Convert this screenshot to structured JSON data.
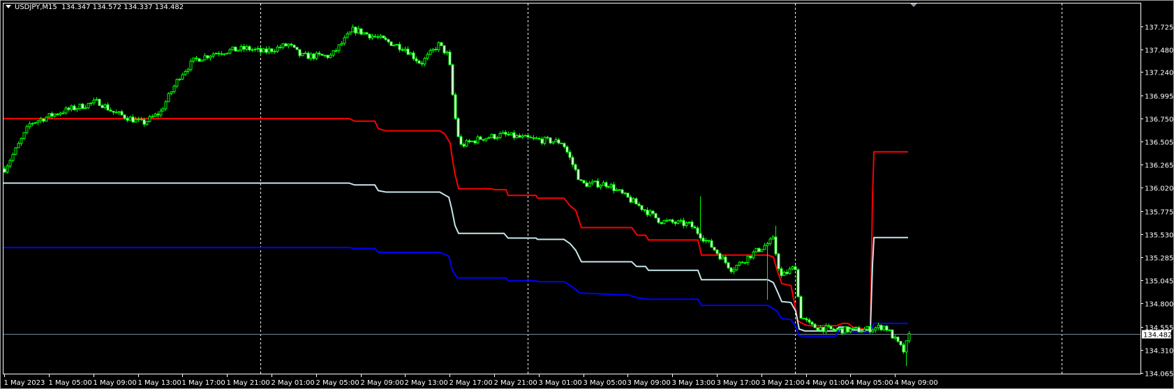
{
  "header": {
    "symbol_timeframe": "USDJPY,M15",
    "ohlc": "134.347 134.572 134.337 134.482"
  },
  "colors": {
    "background": "#000000",
    "candle": "#00ff00",
    "bull_body": "#000000",
    "bear_body": "#ffffff",
    "upper_band": "#ff0000",
    "middle_band": "#c8e6ea",
    "lower_band": "#0000ff",
    "grid": "#ffffff",
    "bid_line": "#778899"
  },
  "chart_data": {
    "type": "candlestick",
    "title": "USDJPY,M15",
    "x_unit": "hours since 1 May 2023 00:00",
    "ylim": [
      134.065,
      137.725
    ],
    "xlim": [
      0.7,
      102.4
    ],
    "y_ticks": [
      "137.725",
      "137.480",
      "137.240",
      "136.995",
      "136.750",
      "136.505",
      "136.265",
      "136.020",
      "135.775",
      "135.530",
      "135.285",
      "135.045",
      "134.800",
      "134.555",
      "134.310",
      "134.065"
    ],
    "x_tick_labels": [
      "1 May 2023",
      "1 May 05:00",
      "1 May 09:00",
      "1 May 13:00",
      "1 May 17:00",
      "1 May 21:00",
      "2 May 01:00",
      "2 May 05:00",
      "2 May 09:00",
      "2 May 13:00",
      "2 May 17:00",
      "2 May 21:00",
      "3 May 01:00",
      "3 May 05:00",
      "3 May 09:00",
      "3 May 13:00",
      "3 May 17:00",
      "3 May 21:00",
      "4 May 01:00",
      "4 May 05:00",
      "4 May 09:00"
    ],
    "day_separators": [
      24,
      48,
      72,
      96
    ],
    "current_price": "134.482",
    "price_path": [
      [
        1,
        136.22
      ],
      [
        2,
        136.42
      ],
      [
        3.3,
        136.7
      ],
      [
        6,
        136.82
      ],
      [
        9.4,
        136.93
      ],
      [
        10.7,
        136.82
      ],
      [
        13.4,
        136.7
      ],
      [
        15,
        136.82
      ],
      [
        16.8,
        137.21
      ],
      [
        18.1,
        137.37
      ],
      [
        20.1,
        137.45
      ],
      [
        22.8,
        137.49
      ],
      [
        24.2,
        137.45
      ],
      [
        26.5,
        137.53
      ],
      [
        27.6,
        137.41
      ],
      [
        30.3,
        137.41
      ],
      [
        32.3,
        137.69
      ],
      [
        34.3,
        137.61
      ],
      [
        37,
        137.49
      ],
      [
        38.4,
        137.33
      ],
      [
        40,
        137.53
      ],
      [
        40.9,
        137.41
      ],
      [
        41.4,
        136.82
      ],
      [
        41.9,
        136.46
      ],
      [
        43.7,
        136.54
      ],
      [
        45.8,
        136.58
      ],
      [
        47.8,
        136.54
      ],
      [
        51.1,
        136.5
      ],
      [
        52.8,
        136.06
      ],
      [
        55.2,
        136.06
      ],
      [
        56.5,
        135.95
      ],
      [
        58.5,
        135.79
      ],
      [
        59.9,
        135.67
      ],
      [
        62.6,
        135.63
      ],
      [
        64.6,
        135.39
      ],
      [
        66.3,
        135.16
      ],
      [
        68,
        135.31
      ],
      [
        70,
        135.47
      ],
      [
        70.7,
        135.08
      ],
      [
        72,
        135.19
      ],
      [
        72.4,
        134.68
      ],
      [
        73.4,
        134.56
      ],
      [
        75.4,
        134.52
      ],
      [
        78.1,
        134.52
      ],
      [
        80.1,
        134.56
      ],
      [
        81.8,
        134.29
      ],
      [
        82.25,
        134.482
      ]
    ],
    "spikes": [
      [
        63.4,
        135.93,
        135.6
      ],
      [
        69.4,
        135.0,
        134.84
      ],
      [
        70.3,
        135.62,
        135.3
      ],
      [
        81.9,
        134.3,
        134.14
      ]
    ],
    "series": [
      {
        "name": "upper",
        "color": "#ff0000",
        "points": [
          [
            0.9,
            136.75
          ],
          [
            31.96,
            136.75
          ],
          [
            32.46,
            136.723
          ],
          [
            34.28,
            136.723
          ],
          [
            34.59,
            136.645
          ],
          [
            35.28,
            136.62
          ],
          [
            40.11,
            136.62
          ],
          [
            40.55,
            136.59
          ],
          [
            41.05,
            136.49
          ],
          [
            41.24,
            136.33
          ],
          [
            41.49,
            136.16
          ],
          [
            41.8,
            136.01
          ],
          [
            44.81,
            136.01
          ],
          [
            45.0,
            136.0
          ],
          [
            46.07,
            136.0
          ],
          [
            46.25,
            135.94
          ],
          [
            48.76,
            135.94
          ],
          [
            48.89,
            135.91
          ],
          [
            51.27,
            135.91
          ],
          [
            51.83,
            135.83
          ],
          [
            52.33,
            135.78
          ],
          [
            52.84,
            135.6
          ],
          [
            57.35,
            135.6
          ],
          [
            57.85,
            135.52
          ],
          [
            58.6,
            135.52
          ],
          [
            58.86,
            135.47
          ],
          [
            63.3,
            135.47
          ],
          [
            63.62,
            135.31
          ],
          [
            69.58,
            135.31
          ],
          [
            70.08,
            135.29
          ],
          [
            70.39,
            135.16
          ],
          [
            70.83,
            135.01
          ],
          [
            71.65,
            134.99
          ],
          [
            71.96,
            134.815
          ],
          [
            72.27,
            134.62
          ],
          [
            72.9,
            134.575
          ],
          [
            73.34,
            134.565
          ],
          [
            75.72,
            134.565
          ],
          [
            76.29,
            134.59
          ],
          [
            76.79,
            134.59
          ],
          [
            77.23,
            134.55
          ],
          [
            78.79,
            134.52
          ],
          [
            78.98,
            135.9
          ],
          [
            79.11,
            136.4
          ],
          [
            82.18,
            136.4
          ]
        ]
      },
      {
        "name": "middle",
        "color": "#c8e6ea",
        "points": [
          [
            0.9,
            136.07
          ],
          [
            31.96,
            136.07
          ],
          [
            32.46,
            136.05
          ],
          [
            34.28,
            136.05
          ],
          [
            34.59,
            135.99
          ],
          [
            35.28,
            135.975
          ],
          [
            40.11,
            135.975
          ],
          [
            40.93,
            135.92
          ],
          [
            41.18,
            135.8
          ],
          [
            41.49,
            135.62
          ],
          [
            41.8,
            135.54
          ],
          [
            45.88,
            135.54
          ],
          [
            46.25,
            135.49
          ],
          [
            48.76,
            135.49
          ],
          [
            48.89,
            135.476
          ],
          [
            51.27,
            135.476
          ],
          [
            51.83,
            135.43
          ],
          [
            52.33,
            135.36
          ],
          [
            52.84,
            135.24
          ],
          [
            57.35,
            135.24
          ],
          [
            57.79,
            135.19
          ],
          [
            58.6,
            135.19
          ],
          [
            58.86,
            135.15
          ],
          [
            63.3,
            135.15
          ],
          [
            63.62,
            135.05
          ],
          [
            69.58,
            135.05
          ],
          [
            70.08,
            135.02
          ],
          [
            70.39,
            134.94
          ],
          [
            70.83,
            134.82
          ],
          [
            71.65,
            134.81
          ],
          [
            72.08,
            134.72
          ],
          [
            72.4,
            134.53
          ],
          [
            72.9,
            134.51
          ],
          [
            75.66,
            134.51
          ],
          [
            75.97,
            134.55
          ],
          [
            76.79,
            134.55
          ],
          [
            77.23,
            134.52
          ],
          [
            78.79,
            134.52
          ],
          [
            78.98,
            135.2
          ],
          [
            79.11,
            135.495
          ],
          [
            82.18,
            135.495
          ]
        ]
      },
      {
        "name": "lower",
        "color": "#0000ff",
        "points": [
          [
            0.9,
            135.39
          ],
          [
            31.96,
            135.39
          ],
          [
            32.46,
            135.38
          ],
          [
            34.28,
            135.38
          ],
          [
            34.59,
            135.34
          ],
          [
            40.11,
            135.34
          ],
          [
            40.93,
            135.3
          ],
          [
            41.24,
            135.15
          ],
          [
            41.68,
            135.07
          ],
          [
            46.07,
            135.07
          ],
          [
            46.25,
            135.04
          ],
          [
            48.76,
            135.04
          ],
          [
            48.89,
            135.03
          ],
          [
            51.27,
            135.03
          ],
          [
            51.83,
            134.99
          ],
          [
            52.33,
            134.95
          ],
          [
            52.65,
            134.91
          ],
          [
            57.04,
            134.89
          ],
          [
            57.85,
            134.86
          ],
          [
            58.86,
            134.845
          ],
          [
            63.3,
            134.845
          ],
          [
            63.62,
            134.78
          ],
          [
            69.58,
            134.78
          ],
          [
            70.39,
            134.72
          ],
          [
            70.83,
            134.64
          ],
          [
            71.65,
            134.63
          ],
          [
            72.08,
            134.56
          ],
          [
            72.4,
            134.46
          ],
          [
            73.15,
            134.455
          ],
          [
            75.66,
            134.455
          ],
          [
            75.97,
            134.525
          ],
          [
            76.79,
            134.525
          ],
          [
            77.23,
            134.5
          ],
          [
            78.79,
            134.5
          ],
          [
            79.11,
            134.59
          ],
          [
            82.18,
            134.59
          ]
        ]
      }
    ]
  }
}
